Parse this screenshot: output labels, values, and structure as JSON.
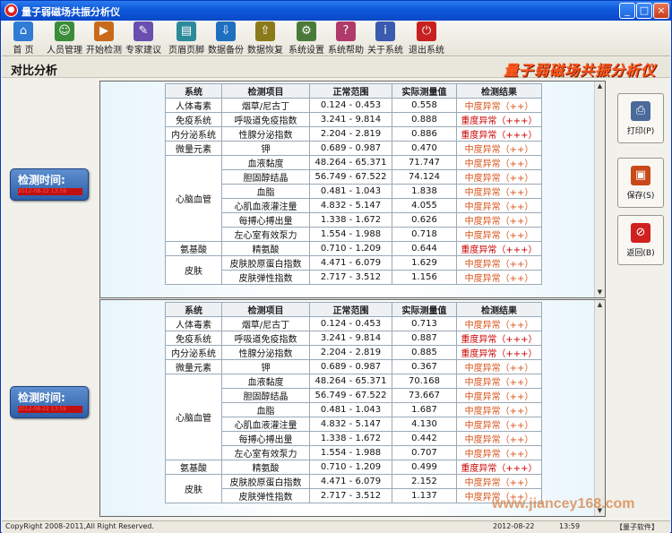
{
  "window": {
    "title": "量子弱磁场共振分析仪",
    "min": "_",
    "max": "□",
    "close": "×"
  },
  "toolbar": [
    {
      "label": "首 页",
      "icon": "home-icon",
      "color": "#2f7bd6",
      "glyph": "⌂"
    },
    {
      "label": "人员管理",
      "icon": "users-icon",
      "color": "#3a8c3a",
      "glyph": "☺"
    },
    {
      "label": "开始检测",
      "icon": "start-icon",
      "color": "#c86a1a",
      "glyph": "▶"
    },
    {
      "label": "专家建议",
      "icon": "expert-icon",
      "color": "#6a4fb0",
      "glyph": "✎"
    },
    {
      "label": "页眉页脚",
      "icon": "header-footer-icon",
      "color": "#2d8a9a",
      "glyph": "▤"
    },
    {
      "label": "数据备份",
      "icon": "backup-icon",
      "color": "#1f6fc0",
      "glyph": "⇩"
    },
    {
      "label": "数据恢复",
      "icon": "restore-icon",
      "color": "#8a7a1a",
      "glyph": "⇧"
    },
    {
      "label": "系统设置",
      "icon": "settings-icon",
      "color": "#4a7a3a",
      "glyph": "⚙"
    },
    {
      "label": "系统帮助",
      "icon": "help-icon",
      "color": "#b03a6a",
      "glyph": "?"
    },
    {
      "label": "关于系统",
      "icon": "about-icon",
      "color": "#3a5ab0",
      "glyph": "i"
    },
    {
      "label": "退出系统",
      "icon": "exit-icon",
      "color": "#c82020",
      "glyph": "⏻"
    }
  ],
  "subheader": {
    "title": "对比分析",
    "brand": "量子弱磁场共振分析仪"
  },
  "headers": [
    "系统",
    "检测项目",
    "正常范围",
    "实际测量值",
    "检测结果"
  ],
  "reports": [
    {
      "time_label": "检测时间:",
      "time_value": "2012-08-22 13:59",
      "rows": [
        {
          "system": "人体毒素",
          "item": "烟草/尼古丁",
          "range": "0.124 - 0.453",
          "value": "0.558",
          "result": "中度异常（++）",
          "severe": false
        },
        {
          "system": "免疫系统",
          "item": "呼吸道免疫指数",
          "range": "3.241 - 9.814",
          "value": "0.888",
          "result": "重度异常（+++）",
          "severe": true
        },
        {
          "system": "内分泌系统",
          "item": "性腺分泌指数",
          "range": "2.204 - 2.819",
          "value": "0.886",
          "result": "重度异常（+++）",
          "severe": true
        },
        {
          "system": "微量元素",
          "item": "钾",
          "range": "0.689 - 0.987",
          "value": "0.470",
          "result": "中度异常（++）",
          "severe": false
        },
        {
          "system": "心脑血管",
          "item": "血液黏度",
          "range": "48.264 - 65.371",
          "value": "71.747",
          "result": "中度异常（++）",
          "severe": false
        },
        {
          "system": "",
          "item": "胆固醇结晶",
          "range": "56.749 - 67.522",
          "value": "74.124",
          "result": "中度异常（++）",
          "severe": false
        },
        {
          "system": "",
          "item": "血脂",
          "range": "0.481 - 1.043",
          "value": "1.838",
          "result": "中度异常（++）",
          "severe": false
        },
        {
          "system": "",
          "item": "心肌血液灌注量",
          "range": "4.832 - 5.147",
          "value": "4.055",
          "result": "中度异常（++）",
          "severe": false
        },
        {
          "system": "",
          "item": "每搏心搏出量",
          "range": "1.338 - 1.672",
          "value": "0.626",
          "result": "中度异常（++）",
          "severe": false
        },
        {
          "system": "",
          "item": "左心室有效泵力",
          "range": "1.554 - 1.988",
          "value": "0.718",
          "result": "中度异常（++）",
          "severe": false
        },
        {
          "system": "氨基酸",
          "item": "精氨酸",
          "range": "0.710 - 1.209",
          "value": "0.644",
          "result": "重度异常（+++）",
          "severe": true
        },
        {
          "system": "皮肤",
          "item": "皮肤胶原蛋白指数",
          "range": "4.471 - 6.079",
          "value": "1.629",
          "result": "中度异常（++）",
          "severe": false
        },
        {
          "system": "",
          "item": "皮肤弹性指数",
          "range": "2.717 - 3.512",
          "value": "1.156",
          "result": "中度异常（++）",
          "severe": false
        }
      ]
    },
    {
      "time_label": "检测时间:",
      "time_value": "2012-08-22 13:59",
      "rows": [
        {
          "system": "人体毒素",
          "item": "烟草/尼古丁",
          "range": "0.124 - 0.453",
          "value": "0.713",
          "result": "中度异常（++）",
          "severe": false
        },
        {
          "system": "免疫系统",
          "item": "呼吸道免疫指数",
          "range": "3.241 - 9.814",
          "value": "0.887",
          "result": "重度异常（+++）",
          "severe": true
        },
        {
          "system": "内分泌系统",
          "item": "性腺分泌指数",
          "range": "2.204 - 2.819",
          "value": "0.885",
          "result": "重度异常（+++）",
          "severe": true
        },
        {
          "system": "微量元素",
          "item": "钾",
          "range": "0.689 - 0.987",
          "value": "0.367",
          "result": "中度异常（++）",
          "severe": false
        },
        {
          "system": "心脑血管",
          "item": "血液黏度",
          "range": "48.264 - 65.371",
          "value": "70.168",
          "result": "中度异常（++）",
          "severe": false
        },
        {
          "system": "",
          "item": "胆固醇结晶",
          "range": "56.749 - 67.522",
          "value": "73.667",
          "result": "中度异常（++）",
          "severe": false
        },
        {
          "system": "",
          "item": "血脂",
          "range": "0.481 - 1.043",
          "value": "1.687",
          "result": "中度异常（++）",
          "severe": false
        },
        {
          "system": "",
          "item": "心肌血液灌注量",
          "range": "4.832 - 5.147",
          "value": "4.130",
          "result": "中度异常（++）",
          "severe": false
        },
        {
          "system": "",
          "item": "每搏心搏出量",
          "range": "1.338 - 1.672",
          "value": "0.442",
          "result": "中度异常（++）",
          "severe": false
        },
        {
          "system": "",
          "item": "左心室有效泵力",
          "range": "1.554 - 1.988",
          "value": "0.707",
          "result": "中度异常（++）",
          "severe": false
        },
        {
          "system": "氨基酸",
          "item": "精氨酸",
          "range": "0.710 - 1.209",
          "value": "0.499",
          "result": "重度异常（+++）",
          "severe": true
        },
        {
          "system": "皮肤",
          "item": "皮肤胶原蛋白指数",
          "range": "4.471 - 6.079",
          "value": "2.152",
          "result": "中度异常（++）",
          "severe": false
        },
        {
          "system": "",
          "item": "皮肤弹性指数",
          "range": "2.717 - 3.512",
          "value": "1.137",
          "result": "中度异常（++）",
          "severe": false
        }
      ]
    }
  ],
  "actions": [
    {
      "label": "打印(P)",
      "icon": "printer-icon",
      "color": "#4a6a9a",
      "glyph": "⎙"
    },
    {
      "label": "保存(S)",
      "icon": "save-icon",
      "color": "#c84a1a",
      "glyph": "▣"
    },
    {
      "label": "返回(B)",
      "icon": "back-icon",
      "color": "#d02020",
      "glyph": "⊘"
    }
  ],
  "status": {
    "copyright": "CopyRight 2008-2011,All Right Reserved.",
    "date": "2012-08-22",
    "time": "13:59",
    "company": "【量子软件】"
  },
  "watermark": "www.jiancey168.com"
}
